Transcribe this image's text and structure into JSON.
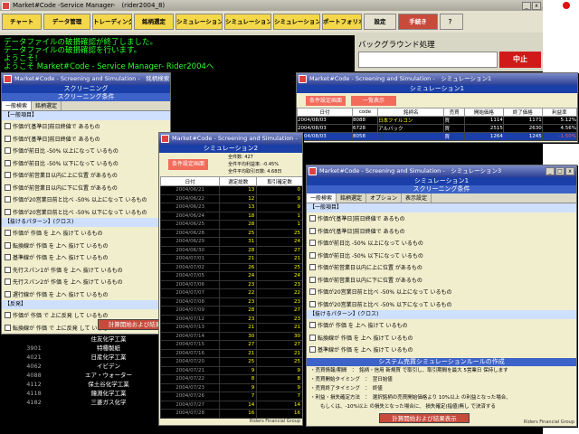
{
  "main": {
    "title": "Market#Code -Service Manager-　(rider2004_8)",
    "toolbar": [
      "チャート",
      "データ管理",
      "トレーディング",
      "銘柄選定",
      "シミュレーション1",
      "シミュレーション2",
      "シミュレーション3",
      "ポートフォリオ",
      "設定",
      "手続き",
      "？"
    ],
    "log": [
      "データファイルの破損確認が終了しました。",
      "データファイルの破損確認を行います。",
      "ようこそ！",
      "ようこそ Market#Code - Service Manager- Rider2004へ"
    ],
    "bg_label": "バックグラウンド処理",
    "stop": "中止"
  },
  "screening": {
    "title": "Market#Code - Screening and Simulation -　銘柄検索",
    "bar1": "スクリーニング",
    "bar2": "スクリーニング条件",
    "tabs": [
      "一般検索",
      "銘柄選定",
      "オプション",
      "表示設定"
    ],
    "sec1": "【一般項目】",
    "rows": [
      "作価が[基準日]前日終値で あるもの",
      "作価が[基準日]前日終値で あるもの",
      "作価が前日比 -50% 以上になって いるもの",
      "作価が前日比 -50% 以下になって いるもの",
      "作価が前営業日以内に上に位置 があるもの",
      "作価が前営業日以内に下に位置 があるもの",
      "作価が20営業日前と比べ -50% 以上になって いるもの",
      "作価が20営業日前と比べ -50% 以下になって いるもの"
    ],
    "sec2": "【抜けるパターン】(クロス)",
    "rows2": [
      "作価が 作価 を 上へ 抜けて いるもの",
      "転換線が 作価 を 上へ 抜けて いるもの",
      "基準線が 作価 を 上へ 抜けて いるもの",
      "先行スパン1が 作価 を 上へ 抜けて いるもの",
      "先行スパン2が 作価 を 上へ 抜けて いるもの",
      "遅行線が 作価 を 上へ 抜けて いるもの"
    ],
    "sec3": "【反発】",
    "rows3": [
      "作価が 作価 で 上に反発 して いるもの",
      "転換線が 作価 で 上に反発 して いるもの"
    ],
    "button": "計算開始および結果"
  },
  "sim1": {
    "title": "Market#Code - Screening and Simulation -　シミュレーション1",
    "bar": "シミュレーション1",
    "b1": "条件設定画面",
    "b2": "一覧表示",
    "headers": [
      "日付",
      "code",
      "銘柄名",
      "売買",
      "開始価格",
      "終了価格",
      "利益率"
    ],
    "rows": [
      [
        "2004/08/03",
        "8088",
        "日本フイルコン",
        "買",
        "1114",
        "1171",
        "5.12%"
      ],
      [
        "2004/08/03",
        "6728",
        "アルバック",
        "買",
        "2515",
        "2630",
        "4.56%"
      ],
      [
        "2004/08/03",
        "8058",
        "",
        "買",
        "1264",
        "1245",
        "-1.50%"
      ]
    ]
  },
  "sim2": {
    "title": "Market#Code - Screening and Simulation -　シミュレーション2",
    "bar": "シミュレーション2",
    "b1": "条件設定画面",
    "stats": [
      "全件数: 427",
      "全件平均利益率: -0.45%",
      "全件平均取引日数: 4.68日"
    ],
    "headers": [
      "日付",
      "選定総数",
      "取引確定数"
    ],
    "rows": [
      [
        "2004/06/21",
        "13",
        "0"
      ],
      [
        "2004/06/22",
        "12",
        "9"
      ],
      [
        "2004/06/23",
        "13",
        "9"
      ],
      [
        "2004/06/24",
        "18",
        "1"
      ],
      [
        "2004/06/25",
        "28",
        "1"
      ],
      [
        "2004/06/28",
        "25",
        "25"
      ],
      [
        "2004/06/29",
        "31",
        "24"
      ],
      [
        "2004/06/30",
        "28",
        "27"
      ],
      [
        "2004/07/01",
        "21",
        "21"
      ],
      [
        "2004/07/02",
        "26",
        "25"
      ],
      [
        "2004/07/05",
        "24",
        "24"
      ],
      [
        "2004/07/06",
        "23",
        "23"
      ],
      [
        "2004/07/07",
        "22",
        "22"
      ],
      [
        "2004/07/08",
        "23",
        "23"
      ],
      [
        "2004/07/09",
        "28",
        "27"
      ],
      [
        "2004/07/12",
        "23",
        "23"
      ],
      [
        "2004/07/13",
        "21",
        "21"
      ],
      [
        "2004/07/14",
        "30",
        "30"
      ],
      [
        "2004/07/15",
        "27",
        "27"
      ],
      [
        "2004/07/16",
        "21",
        "21"
      ],
      [
        "2004/07/20",
        "25",
        "25"
      ],
      [
        "2004/07/21",
        "9",
        "9"
      ],
      [
        "2004/07/22",
        "8",
        "8"
      ],
      [
        "2004/07/23",
        "9",
        "9"
      ],
      [
        "2004/07/26",
        "7",
        "7"
      ],
      [
        "2004/07/27",
        "14",
        "14"
      ],
      [
        "2004/07/28",
        "16",
        "16"
      ]
    ],
    "footer": "Riders Financial Group"
  },
  "sim3": {
    "title": "Market#Code - Screening and Simulation -　シミュレーション3",
    "bar1": "シミュレーション1",
    "bar2": "スクリーニング条件",
    "tabs": [
      "一般検索",
      "銘柄選定",
      "オプション",
      "表示設定"
    ],
    "sec1": "【一般項目】",
    "rows": [
      "作価が[基準日]前日終値で あるもの",
      "作価が[基準日]前日終値で あるもの",
      "作価が前日比 -50% 以上になって いるもの",
      "作価が前日比 -50% 以下になって いるもの",
      "作価が前営業日以内に上に位置 があるもの",
      "作価が前営業日以内に下に位置 があるもの",
      "作価が20営業日前と比べ -50% 以上になって いるもの",
      "作価が20営業日前と比べ -50% 以下になって いるもの"
    ],
    "sec2": "【抜けるパターン】(クロス)",
    "rows2": [
      "作価が 作価 を 上へ 抜けて いるもの",
      "転換線が 作価 を 上へ 抜けて いるもの",
      "基準線が 作価 を 上へ 抜けて いるもの"
    ],
    "rule_bar": "システム売買シミュレーションルールの作成",
    "rules": [
      "・売買情報/期間　：　銘柄・信用 新規買 で取引し、取引期間を最大 5営業日 保持します",
      "・売買開始タイミング　：　翌日始値",
      "・売買終了タイミング　：　終値",
      "・利益・損失確定方法　：　選択銘柄の売買開始価格より 10%以上 の利益となった場合、",
      "　　もしくは、-10%以上 の損失となった場合に、 損失確定(指値)無し で決済する"
    ],
    "button": "計算開始および結果表示",
    "footer": "Riders Financial Group"
  },
  "list": {
    "rows": [
      [
        "",
        "住友化学工業"
      ],
      [
        "3901",
        "特種製紙"
      ],
      [
        "4021",
        "日産化学工業"
      ],
      [
        "4062",
        "イビデン"
      ],
      [
        "4088",
        "エア・ウォーター"
      ],
      [
        "4112",
        "保土谷化学工業"
      ],
      [
        "4118",
        "鐘淵化学工業"
      ],
      [
        "4182",
        "三菱ガス化学"
      ]
    ]
  }
}
